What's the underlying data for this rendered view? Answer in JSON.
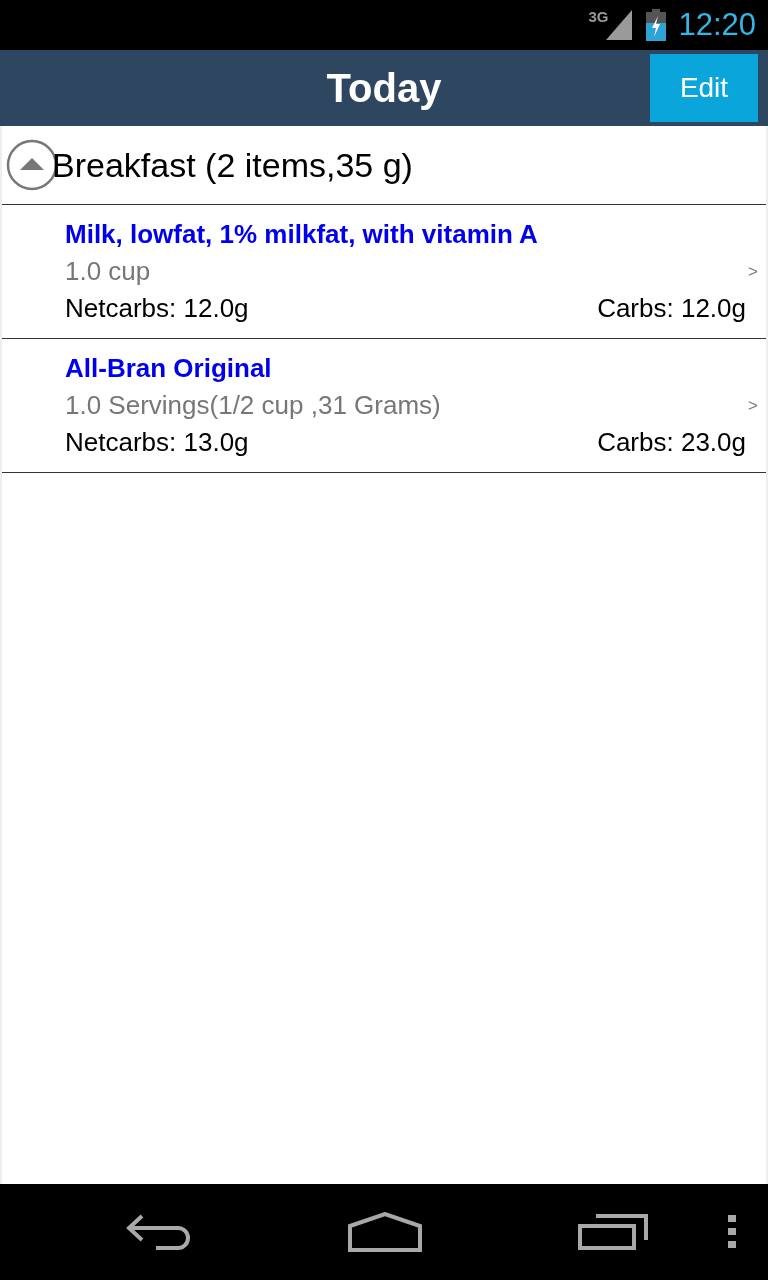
{
  "status_bar": {
    "network": "3G",
    "time": "12:20"
  },
  "header": {
    "title": "Today",
    "edit_button": "Edit"
  },
  "group": {
    "title": "Breakfast (2 items,35 g)",
    "expanded": true,
    "items": [
      {
        "name": "Milk, lowfat, 1% milkfat, with vitamin A",
        "serving": "1.0 cup",
        "chevron": ">",
        "netcarbs": "Netcarbs: 12.0g",
        "carbs": "Carbs: 12.0g"
      },
      {
        "name": "All-Bran Original",
        "serving": "1.0 Servings(1/2 cup ,31 Grams)",
        "chevron": ">",
        "netcarbs": "Netcarbs: 13.0g",
        "carbs": "Carbs: 23.0g"
      }
    ]
  }
}
